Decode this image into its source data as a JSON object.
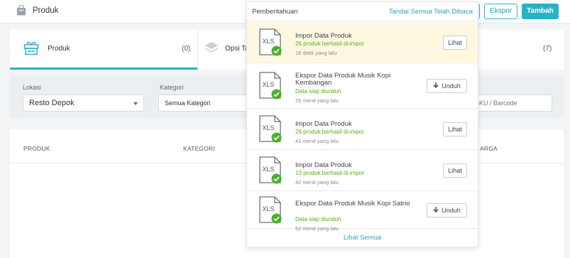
{
  "header": {
    "title": "Produk",
    "buttons": {
      "ekspor": "Ekspor",
      "tambah": "Tambah"
    }
  },
  "tabs": [
    {
      "label": "Produk",
      "count": "(0)"
    },
    {
      "label": "Opsi Ta",
      "count": "(7)"
    }
  ],
  "filters": {
    "lokasi_label": "Lokasi",
    "lokasi_value": "Resto Depok",
    "kategori_label": "Kategori",
    "kategori_value": "Semua Kategori",
    "search_placeholder": "SKU / Barcode"
  },
  "table": {
    "headers": [
      "PRODUK",
      "KATEGORI",
      "ARGA"
    ]
  },
  "notifications": {
    "title": "Pemberitahuan",
    "mark_all": "Tandai Semua Telah Dibaca",
    "file_type": "XLS",
    "items": [
      {
        "title": "Impor Data Produk",
        "subtitle": "26 produk berhasil di-impor",
        "time": "16 detik yang lalu",
        "action": "Lihat"
      },
      {
        "title": "Ekspor Data Produk Musik Kopi Kembangan",
        "subtitle": "Data siap diunduh",
        "time": "25 menit yang lalu",
        "action": "Unduh"
      },
      {
        "title": "Impor Data Produk",
        "subtitle": "26 produk berhasil di-impor",
        "time": "41 menit yang lalu",
        "action": "Lihat"
      },
      {
        "title": "Impor Data Produk",
        "subtitle": "13 produk berhasil di-impor",
        "time": "42 menit yang lalu",
        "action": "Lihat"
      },
      {
        "title": "Ekspor Data Produk Musik Kopi Satrio",
        "subtitle": "Data siap diunduh",
        "time": "52 menit yang lalu",
        "action": "Unduh"
      }
    ],
    "see_all": "Lihat Semua"
  },
  "icons": {
    "bag": "shopping-bag-icon",
    "product": "gift-box-icon",
    "options": "layers-icon",
    "file": "xls-file-icon",
    "check": "check-circle-icon",
    "download": "download-arrow-icon"
  },
  "colors": {
    "accent": "#29b3c6",
    "success": "#5aaa1e",
    "highlight": "#fff8e1"
  }
}
